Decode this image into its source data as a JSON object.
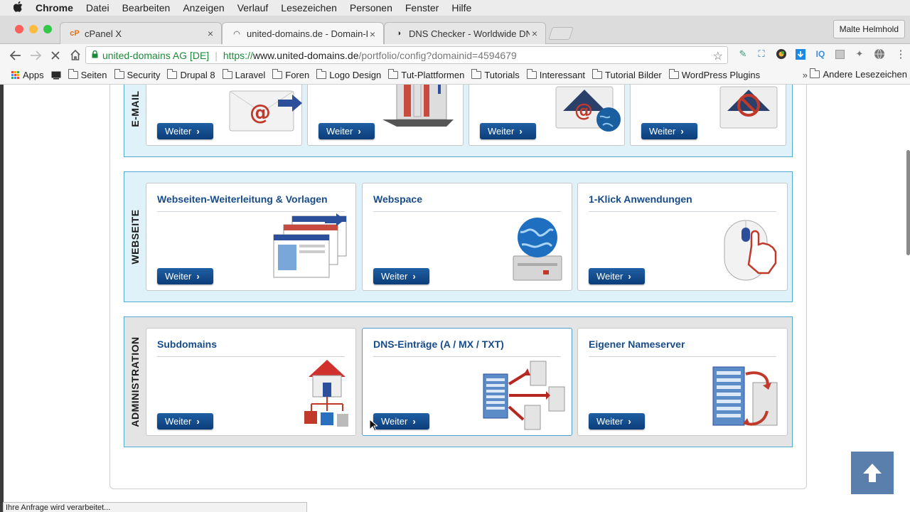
{
  "menubar": {
    "apple": "",
    "items": [
      "Chrome",
      "Datei",
      "Bearbeiten",
      "Anzeigen",
      "Verlauf",
      "Lesezeichen",
      "Personen",
      "Fenster",
      "Hilfe"
    ]
  },
  "tabs": [
    {
      "favicon": "cP",
      "title": "cPanel X",
      "close": "×"
    },
    {
      "favicon": "◠",
      "title": "united-domains.de - Domain-P",
      "close": "×"
    },
    {
      "favicon": "◑",
      "title": "DNS Checker - Worldwide DNS",
      "close": "×"
    }
  ],
  "profile_name": "Malte Helmhold",
  "omnibox": {
    "org": "united-domains AG [DE]",
    "scheme": "https://",
    "host": "www.united-domains.de",
    "path": "/portfolio/config?domainid=4594679"
  },
  "toolbar_icons": [
    "back-icon",
    "forward-icon",
    "stop-icon",
    "home-icon"
  ],
  "extension_icons": [
    "IQ"
  ],
  "bookmarks": {
    "apps_label": "Apps",
    "items": [
      "Seiten",
      "Security",
      "Drupal 8",
      "Laravel",
      "Foren",
      "Logo Design",
      "Tut-Plattformen",
      "Tutorials",
      "Interessant",
      "Tutorial Bilder",
      "WordPress Plugins"
    ],
    "more": "»",
    "other": "Andere Lesezeichen"
  },
  "sections": {
    "email": {
      "label": "E-MAIL",
      "button": "Weiter"
    },
    "webseite": {
      "label": "WEBSEITE",
      "cards": [
        "Webseiten-Weiterleitung & Vorlagen",
        "Webspace",
        "1-Klick Anwendungen"
      ],
      "button": "Weiter"
    },
    "administration": {
      "label": "ADMINISTRATION",
      "cards": [
        "Subdomains",
        "DNS-Einträge (A / MX / TXT)",
        "Eigener Nameserver"
      ],
      "button": "Weiter"
    }
  },
  "status_text": "Ihre Anfrage wird verarbeitet...",
  "colors": {
    "accent": "#174c8c",
    "section_bg": "#dff2f9",
    "section_border": "#52aacd",
    "button": "#0b3d7a"
  }
}
